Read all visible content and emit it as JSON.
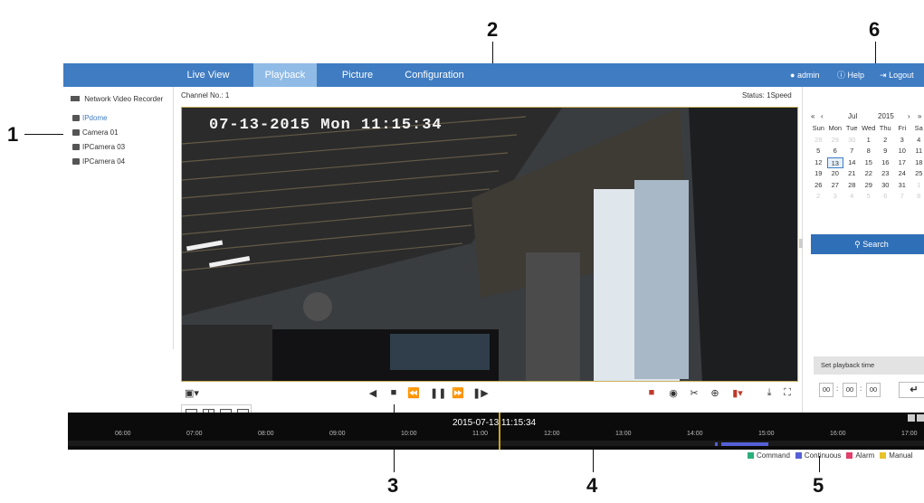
{
  "callouts": [
    "1",
    "2",
    "3",
    "4",
    "5",
    "6"
  ],
  "nav": {
    "items": [
      "Live View",
      "Playback",
      "Picture",
      "Configuration"
    ],
    "active": "Playback",
    "user": "admin",
    "help": "Help",
    "logout": "Logout"
  },
  "sidebar": {
    "root": "Network Video Recorder",
    "cameras": [
      "IPdome",
      "Camera 01",
      "IPCamera 03",
      "IPCamera 04"
    ]
  },
  "channel_label": "Channel No.: 1",
  "status_label": "Status: 1Speed",
  "osd_text": "07-13-2015 Mon 11:15:34",
  "calendar": {
    "month": "Jul",
    "year": "2015",
    "weekdays": [
      "Sun",
      "Mon",
      "Tue",
      "Wed",
      "Thu",
      "Fri",
      "Sa"
    ],
    "rows": [
      [
        "28",
        "29",
        "30",
        "1",
        "2",
        "3",
        "4"
      ],
      [
        "5",
        "6",
        "7",
        "8",
        "9",
        "10",
        "11"
      ],
      [
        "12",
        "13",
        "14",
        "15",
        "16",
        "17",
        "18"
      ],
      [
        "19",
        "20",
        "21",
        "22",
        "23",
        "24",
        "25"
      ],
      [
        "26",
        "27",
        "28",
        "29",
        "30",
        "31",
        "1"
      ],
      [
        "2",
        "3",
        "4",
        "5",
        "6",
        "7",
        "8"
      ]
    ],
    "today": "13"
  },
  "search_label": "Search",
  "playback_time": {
    "label": "Set playback time",
    "h": "00",
    "m": "00",
    "s": "00"
  },
  "timeline": {
    "current": "2015-07-13 11:15:34",
    "ticks": [
      "06:00",
      "07:00",
      "08:00",
      "09:00",
      "10:00",
      "11:00",
      "12:00",
      "13:00",
      "14:00",
      "15:00",
      "16:00",
      "17:00"
    ]
  },
  "legend": [
    {
      "label": "Command",
      "color": "#2bb07a"
    },
    {
      "label": "Continuous",
      "color": "#5560d6"
    },
    {
      "label": "Alarm",
      "color": "#e0406a"
    },
    {
      "label": "Manual",
      "color": "#e8c22a"
    }
  ]
}
